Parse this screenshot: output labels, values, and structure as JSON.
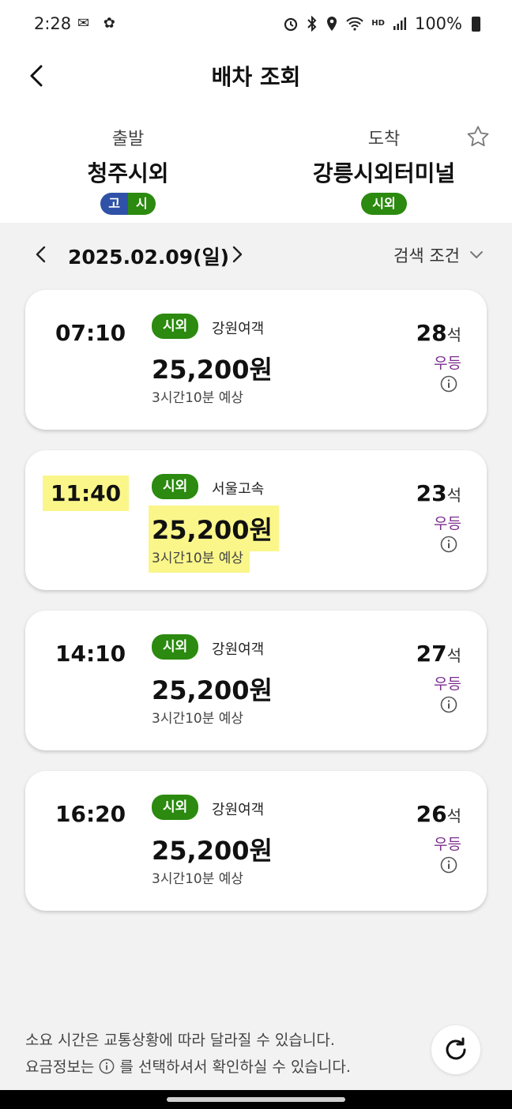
{
  "status_bar": {
    "time": "2:28",
    "left_icons": "✉ ✿",
    "hd_label": "HD",
    "battery": "100%"
  },
  "header": {
    "title": "배차 조회"
  },
  "route": {
    "departure_label": "출발",
    "departure_name": "청주시외",
    "departure_tags": [
      "고",
      "시"
    ],
    "arrival_label": "도착",
    "arrival_name": "강릉시외터미널",
    "arrival_tag": "시외"
  },
  "date_bar": {
    "date": "2025.02.09(일)",
    "filter_label": "검색 조건"
  },
  "buses": [
    {
      "time": "07:10",
      "type": "시외",
      "company": "강원여객",
      "price": "25,200원",
      "duration": "3시간10분 예상",
      "seats": "28",
      "seat_unit": "석",
      "class": "우등"
    },
    {
      "time": "11:40",
      "type": "시외",
      "company": "서울고속",
      "price": "25,200원",
      "duration": "3시간10분 예상",
      "seats": "23",
      "seat_unit": "석",
      "class": "우등"
    },
    {
      "time": "14:10",
      "type": "시외",
      "company": "강원여객",
      "price": "25,200원",
      "duration": "3시간10분 예상",
      "seats": "27",
      "seat_unit": "석",
      "class": "우등"
    },
    {
      "time": "16:20",
      "type": "시외",
      "company": "강원여객",
      "price": "25,200원",
      "duration": "3시간10분 예상",
      "seats": "26",
      "seat_unit": "석",
      "class": "우등"
    }
  ],
  "notice": {
    "line1": "소요 시간은 교통상황에 따라 달라질 수 있습니다.",
    "line2_before": "요금정보는",
    "line2_after": "를 선택하셔서 확인하실 수 있습니다."
  },
  "colors": {
    "badge_green": "#2b8a0f",
    "badge_blue": "#2f52a8",
    "class_purple": "#7b2e8e",
    "highlight": "#faf68a"
  }
}
